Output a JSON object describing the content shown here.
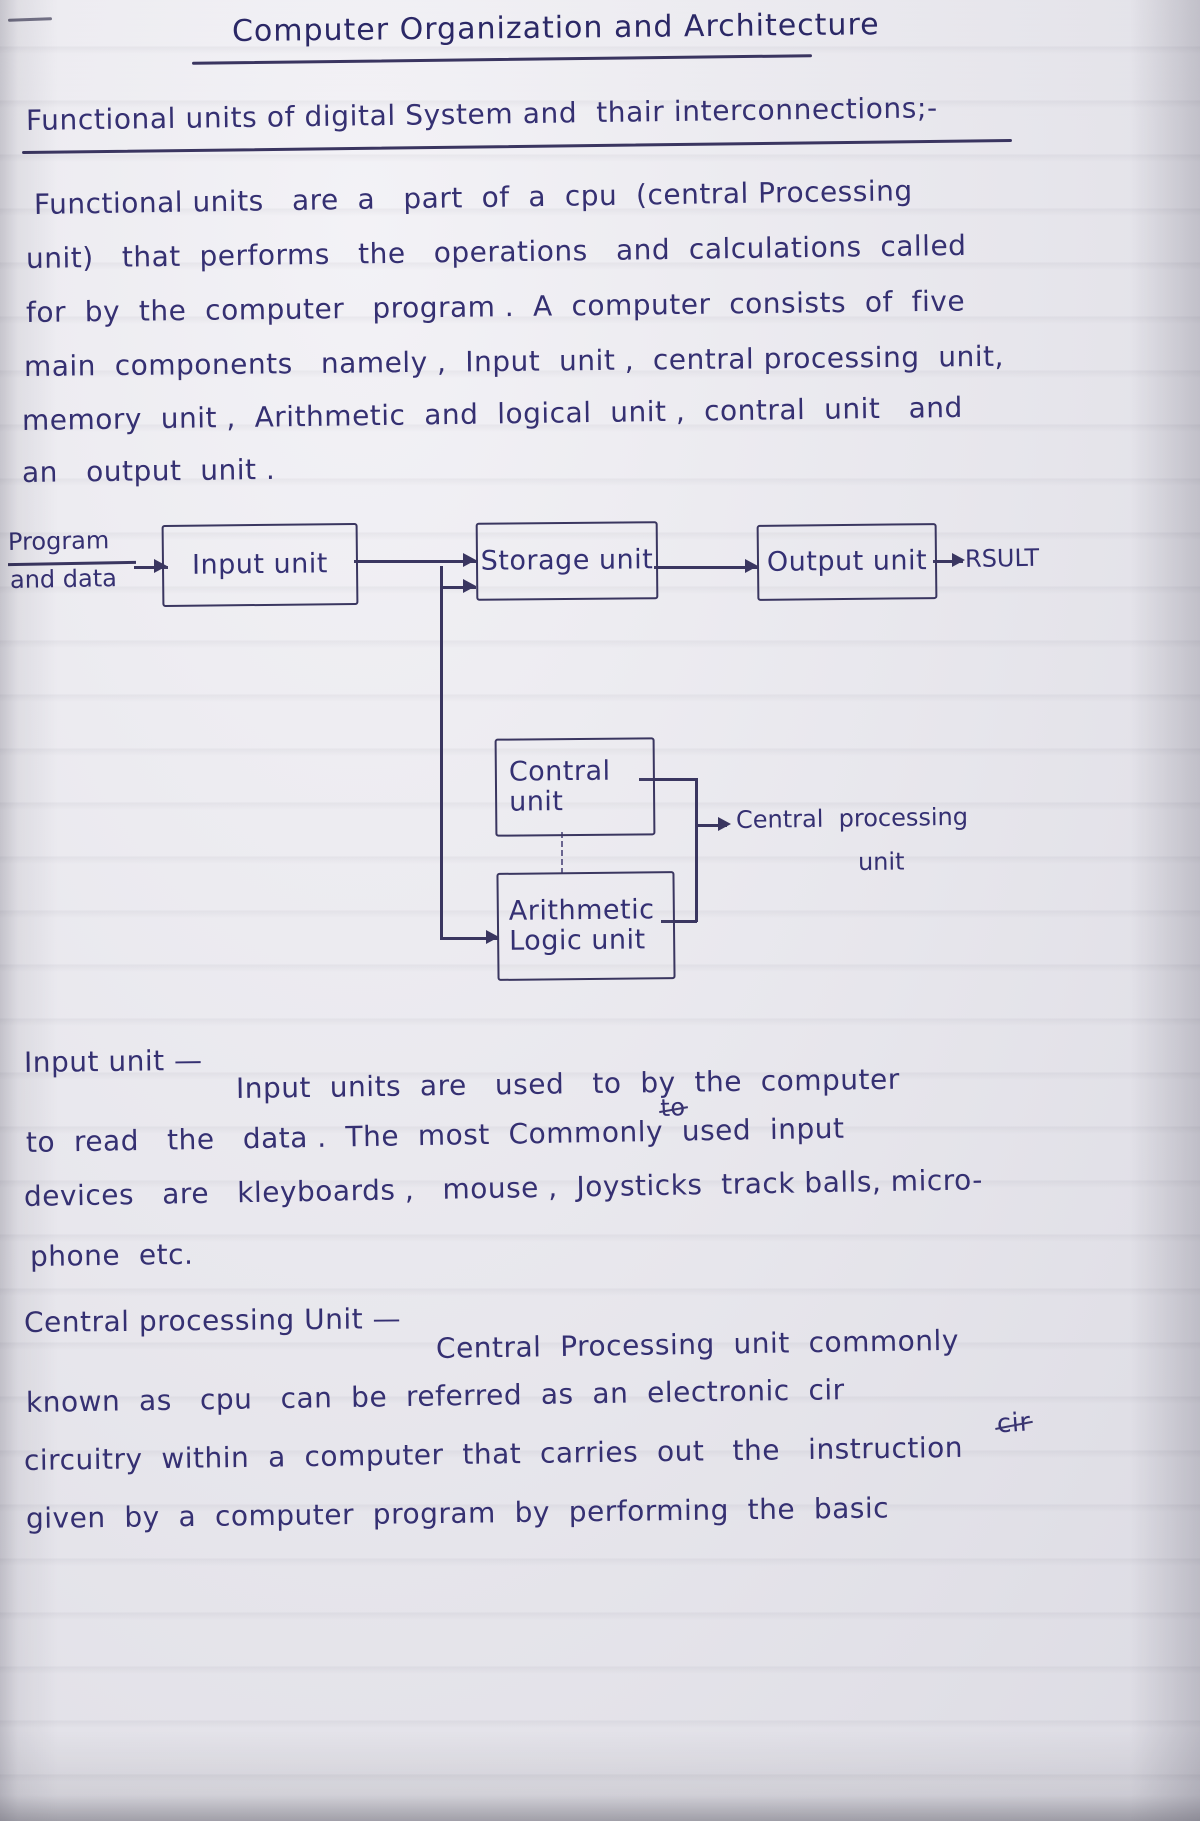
{
  "document": {
    "kind": "handwritten-notes-page",
    "title": "Computer Organization and Architecture",
    "heading": "Functional units of digital System and  thair interconnections;-",
    "ink_color": "#343073",
    "paper_color": "#e9e8ee"
  },
  "intro_paragraph": {
    "lines": [
      "Functional units   are  a   part  of  a  cpu  (central Processing",
      "unit)   that  performs   the   operations   and  calculations  called",
      "for  by  the  computer   program .  A  computer  consists  of  five",
      "main  components   namely ,  Input  unit ,  central processing  unit,",
      "memory  unit ,  Arithmetic  and  logical  unit ,  contral  unit   and",
      "an   output  unit ."
    ]
  },
  "diagram": {
    "name": "functional-units-block-diagram",
    "input_label_line1": "Program",
    "input_label_line2": "and data",
    "boxes": [
      {
        "id": "input-unit",
        "label": "Input unit"
      },
      {
        "id": "storage-unit",
        "label": "Storage unit"
      },
      {
        "id": "output-unit",
        "label": "Output unit"
      },
      {
        "id": "control-unit",
        "label": "Contral\nunit"
      },
      {
        "id": "alu",
        "label": "Arithmetic\nLogic unit"
      }
    ],
    "result_label": "RSULT",
    "cpu_bracket_label_line1": "Central  processing",
    "cpu_bracket_label_line2": "unit"
  },
  "sections": [
    {
      "id": "input-unit-section",
      "term": "Input unit —",
      "lines": [
        "Input  units  are   used   to  by  the  computer",
        "to  read   the   data .  The  most  Commonly  used  input",
        "devices   are   kleyboards ,   mouse ,  Joysticks  track balls, micro-",
        "phone  etc."
      ],
      "struck_word": "to"
    },
    {
      "id": "central-processing-unit-section",
      "term": "Central processing Unit —",
      "lines": [
        "Central  Processing  unit  commonly",
        "known  as   cpu   can  be  referred  as  an  electronic  cir",
        "circuitry  within  a  computer  that  carries  out   the   instruction",
        "given  by  a  computer  program  by  performing  the  basic"
      ],
      "struck_word": "cir"
    }
  ]
}
